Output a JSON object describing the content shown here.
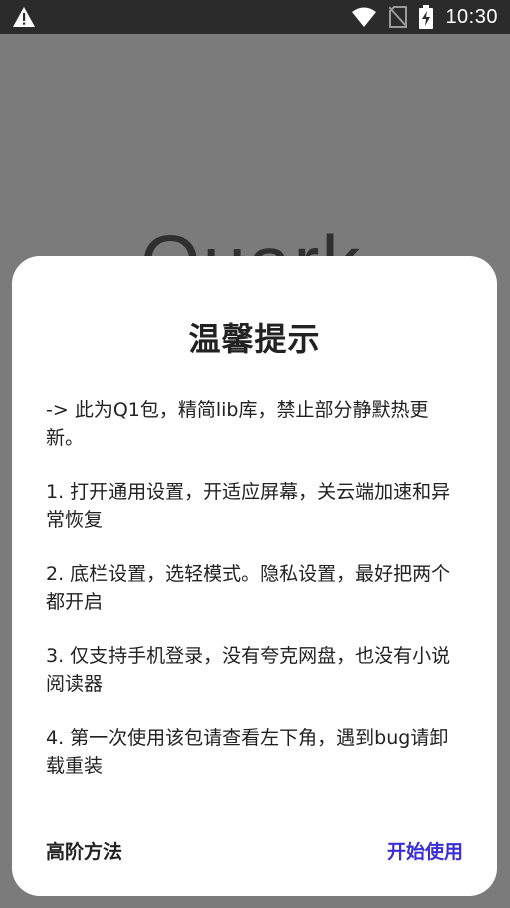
{
  "status_bar": {
    "time": "10:30",
    "icons": [
      "warning-icon",
      "wifi-icon",
      "no-sim-icon",
      "battery-charging-icon"
    ]
  },
  "background": {
    "logo_text": "Quark"
  },
  "dialog": {
    "title": "温馨提示",
    "paragraphs": [
      "-> 此为Q1包，精简lib库，禁止部分静默热更新。",
      "1. 打开通用设置，开适应屏幕，关云端加速和异常恢复",
      "2. 底栏设置，选轻模式。隐私设置，最好把两个都开启",
      "3. 仅支持手机登录，没有夸克网盘，也没有小说阅读器",
      "4. 第一次使用该包请查看左下角，遇到bug请卸载重装"
    ],
    "secondary_button": "高阶方法",
    "primary_button": "开始使用"
  },
  "colors": {
    "primary_accent": "#3a2ed6",
    "overlay": "#7b7b7b",
    "status_bar": "#2b2b2b"
  }
}
